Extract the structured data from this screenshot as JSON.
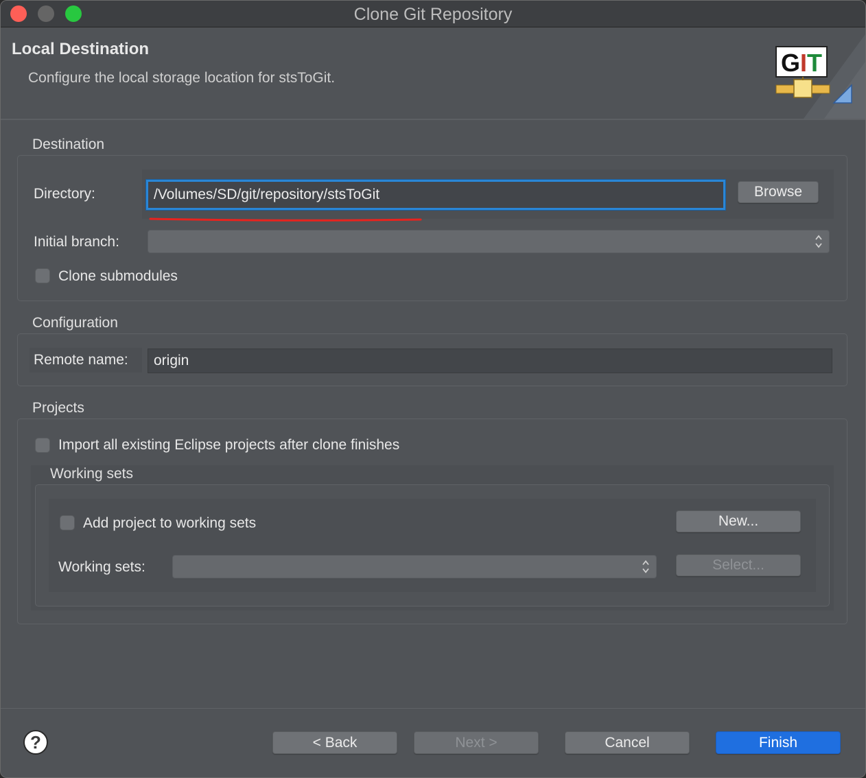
{
  "window": {
    "title": "Clone Git Repository"
  },
  "header": {
    "title": "Local Destination",
    "description": "Configure the local storage location for stsToGit.",
    "logo_text": "GIT"
  },
  "destination": {
    "group_label": "Destination",
    "directory_label": "Directory:",
    "directory_value": "/Volumes/SD/git/repository/stsToGit",
    "browse_label": "Browse",
    "initial_branch_label": "Initial branch:",
    "initial_branch_value": "",
    "clone_submodules_label": "Clone submodules"
  },
  "configuration": {
    "group_label": "Configuration",
    "remote_name_label": "Remote name:",
    "remote_name_value": "origin"
  },
  "projects": {
    "group_label": "Projects",
    "import_label": "Import all existing Eclipse projects after clone finishes",
    "working_sets": {
      "group_label": "Working sets",
      "add_label": "Add project to working sets",
      "new_label": "New...",
      "sets_label": "Working sets:",
      "sets_value": "",
      "select_label": "Select..."
    }
  },
  "footer": {
    "back_label": "< Back",
    "next_label": "Next >",
    "cancel_label": "Cancel",
    "finish_label": "Finish"
  },
  "colors": {
    "accent": "#1f6fe0",
    "focus_ring": "#2a86d6",
    "annotation_underline": "#e8231e"
  }
}
